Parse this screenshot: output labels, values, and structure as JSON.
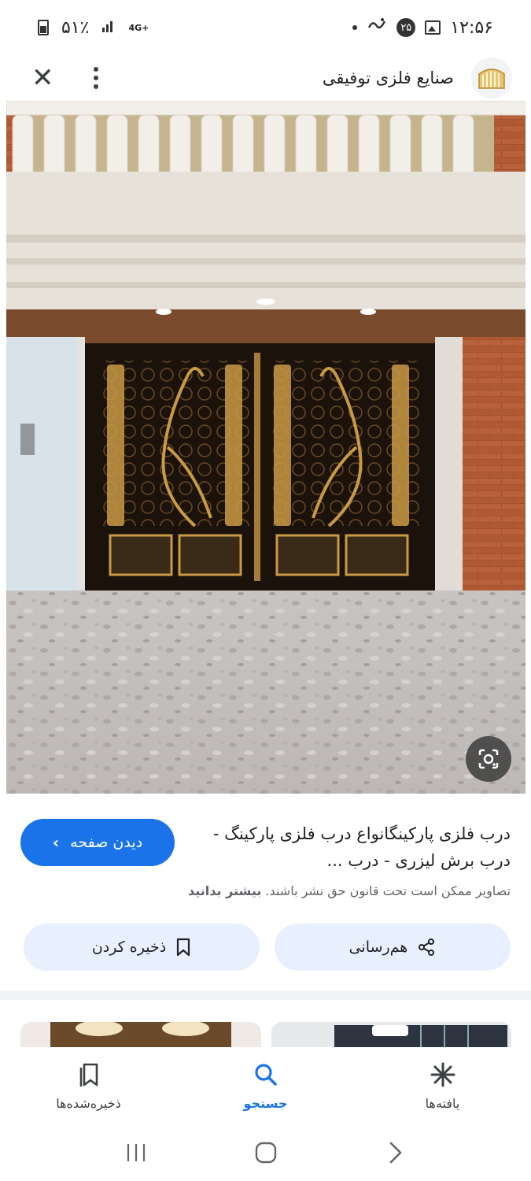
{
  "status_bar": {
    "time": "۱۲:۵۶",
    "notification_count": "۲۵",
    "battery": "۵۱٪",
    "network": "4G+"
  },
  "header": {
    "site_title": "صنایع فلزی توفیقی",
    "close_icon": "close-icon",
    "more_icon": "more-vert-icon"
  },
  "result": {
    "caption": "درب فلزی پارکینگانواع درب فلزی پارکینگ - درب برش لیزری - درب ...",
    "visit_label": "دیدن صفحه",
    "copyright_text": "تصاویر ممکن است تحت قانون حق نشر باشند.",
    "learn_more": "بیشتر بدانید",
    "share_label": "هم‌رسانی",
    "save_label": "ذخیره کردن"
  },
  "bottom_nav": {
    "items": [
      {
        "label": "ذخیره‌شده‌ها",
        "icon": "bookmarks-icon",
        "active": false
      },
      {
        "label": "جستجو",
        "icon": "search-icon",
        "active": true
      },
      {
        "label": "یافته‌ها",
        "icon": "asterisk-icon",
        "active": false
      }
    ]
  },
  "colors": {
    "accent": "#1a73e8",
    "pill_bg": "#e8f0fe",
    "text": "#202124",
    "muted": "#5f6368"
  }
}
